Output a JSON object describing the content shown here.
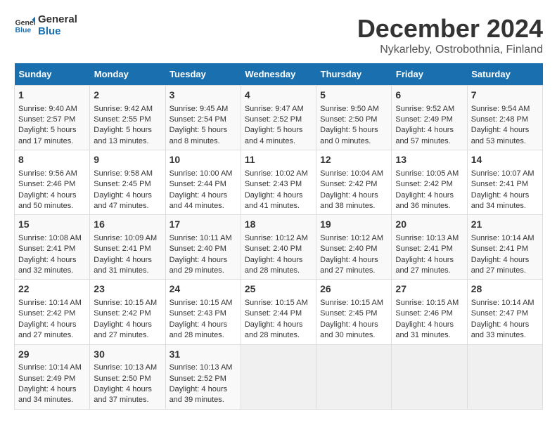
{
  "header": {
    "logo_line1": "General",
    "logo_line2": "Blue",
    "month": "December 2024",
    "location": "Nykarleby, Ostrobothnia, Finland"
  },
  "weekdays": [
    "Sunday",
    "Monday",
    "Tuesday",
    "Wednesday",
    "Thursday",
    "Friday",
    "Saturday"
  ],
  "weeks": [
    [
      {
        "day": "1",
        "lines": [
          "Sunrise: 9:40 AM",
          "Sunset: 2:57 PM",
          "Daylight: 5 hours",
          "and 17 minutes."
        ]
      },
      {
        "day": "2",
        "lines": [
          "Sunrise: 9:42 AM",
          "Sunset: 2:55 PM",
          "Daylight: 5 hours",
          "and 13 minutes."
        ]
      },
      {
        "day": "3",
        "lines": [
          "Sunrise: 9:45 AM",
          "Sunset: 2:54 PM",
          "Daylight: 5 hours",
          "and 8 minutes."
        ]
      },
      {
        "day": "4",
        "lines": [
          "Sunrise: 9:47 AM",
          "Sunset: 2:52 PM",
          "Daylight: 5 hours",
          "and 4 minutes."
        ]
      },
      {
        "day": "5",
        "lines": [
          "Sunrise: 9:50 AM",
          "Sunset: 2:50 PM",
          "Daylight: 5 hours",
          "and 0 minutes."
        ]
      },
      {
        "day": "6",
        "lines": [
          "Sunrise: 9:52 AM",
          "Sunset: 2:49 PM",
          "Daylight: 4 hours",
          "and 57 minutes."
        ]
      },
      {
        "day": "7",
        "lines": [
          "Sunrise: 9:54 AM",
          "Sunset: 2:48 PM",
          "Daylight: 4 hours",
          "and 53 minutes."
        ]
      }
    ],
    [
      {
        "day": "8",
        "lines": [
          "Sunrise: 9:56 AM",
          "Sunset: 2:46 PM",
          "Daylight: 4 hours",
          "and 50 minutes."
        ]
      },
      {
        "day": "9",
        "lines": [
          "Sunrise: 9:58 AM",
          "Sunset: 2:45 PM",
          "Daylight: 4 hours",
          "and 47 minutes."
        ]
      },
      {
        "day": "10",
        "lines": [
          "Sunrise: 10:00 AM",
          "Sunset: 2:44 PM",
          "Daylight: 4 hours",
          "and 44 minutes."
        ]
      },
      {
        "day": "11",
        "lines": [
          "Sunrise: 10:02 AM",
          "Sunset: 2:43 PM",
          "Daylight: 4 hours",
          "and 41 minutes."
        ]
      },
      {
        "day": "12",
        "lines": [
          "Sunrise: 10:04 AM",
          "Sunset: 2:42 PM",
          "Daylight: 4 hours",
          "and 38 minutes."
        ]
      },
      {
        "day": "13",
        "lines": [
          "Sunrise: 10:05 AM",
          "Sunset: 2:42 PM",
          "Daylight: 4 hours",
          "and 36 minutes."
        ]
      },
      {
        "day": "14",
        "lines": [
          "Sunrise: 10:07 AM",
          "Sunset: 2:41 PM",
          "Daylight: 4 hours",
          "and 34 minutes."
        ]
      }
    ],
    [
      {
        "day": "15",
        "lines": [
          "Sunrise: 10:08 AM",
          "Sunset: 2:41 PM",
          "Daylight: 4 hours",
          "and 32 minutes."
        ]
      },
      {
        "day": "16",
        "lines": [
          "Sunrise: 10:09 AM",
          "Sunset: 2:41 PM",
          "Daylight: 4 hours",
          "and 31 minutes."
        ]
      },
      {
        "day": "17",
        "lines": [
          "Sunrise: 10:11 AM",
          "Sunset: 2:40 PM",
          "Daylight: 4 hours",
          "and 29 minutes."
        ]
      },
      {
        "day": "18",
        "lines": [
          "Sunrise: 10:12 AM",
          "Sunset: 2:40 PM",
          "Daylight: 4 hours",
          "and 28 minutes."
        ]
      },
      {
        "day": "19",
        "lines": [
          "Sunrise: 10:12 AM",
          "Sunset: 2:40 PM",
          "Daylight: 4 hours",
          "and 27 minutes."
        ]
      },
      {
        "day": "20",
        "lines": [
          "Sunrise: 10:13 AM",
          "Sunset: 2:41 PM",
          "Daylight: 4 hours",
          "and 27 minutes."
        ]
      },
      {
        "day": "21",
        "lines": [
          "Sunrise: 10:14 AM",
          "Sunset: 2:41 PM",
          "Daylight: 4 hours",
          "and 27 minutes."
        ]
      }
    ],
    [
      {
        "day": "22",
        "lines": [
          "Sunrise: 10:14 AM",
          "Sunset: 2:42 PM",
          "Daylight: 4 hours",
          "and 27 minutes."
        ]
      },
      {
        "day": "23",
        "lines": [
          "Sunrise: 10:15 AM",
          "Sunset: 2:42 PM",
          "Daylight: 4 hours",
          "and 27 minutes."
        ]
      },
      {
        "day": "24",
        "lines": [
          "Sunrise: 10:15 AM",
          "Sunset: 2:43 PM",
          "Daylight: 4 hours",
          "and 28 minutes."
        ]
      },
      {
        "day": "25",
        "lines": [
          "Sunrise: 10:15 AM",
          "Sunset: 2:44 PM",
          "Daylight: 4 hours",
          "and 28 minutes."
        ]
      },
      {
        "day": "26",
        "lines": [
          "Sunrise: 10:15 AM",
          "Sunset: 2:45 PM",
          "Daylight: 4 hours",
          "and 30 minutes."
        ]
      },
      {
        "day": "27",
        "lines": [
          "Sunrise: 10:15 AM",
          "Sunset: 2:46 PM",
          "Daylight: 4 hours",
          "and 31 minutes."
        ]
      },
      {
        "day": "28",
        "lines": [
          "Sunrise: 10:14 AM",
          "Sunset: 2:47 PM",
          "Daylight: 4 hours",
          "and 33 minutes."
        ]
      }
    ],
    [
      {
        "day": "29",
        "lines": [
          "Sunrise: 10:14 AM",
          "Sunset: 2:49 PM",
          "Daylight: 4 hours",
          "and 34 minutes."
        ]
      },
      {
        "day": "30",
        "lines": [
          "Sunrise: 10:13 AM",
          "Sunset: 2:50 PM",
          "Daylight: 4 hours",
          "and 37 minutes."
        ]
      },
      {
        "day": "31",
        "lines": [
          "Sunrise: 10:13 AM",
          "Sunset: 2:52 PM",
          "Daylight: 4 hours",
          "and 39 minutes."
        ]
      },
      {
        "day": "",
        "lines": []
      },
      {
        "day": "",
        "lines": []
      },
      {
        "day": "",
        "lines": []
      },
      {
        "day": "",
        "lines": []
      }
    ]
  ]
}
